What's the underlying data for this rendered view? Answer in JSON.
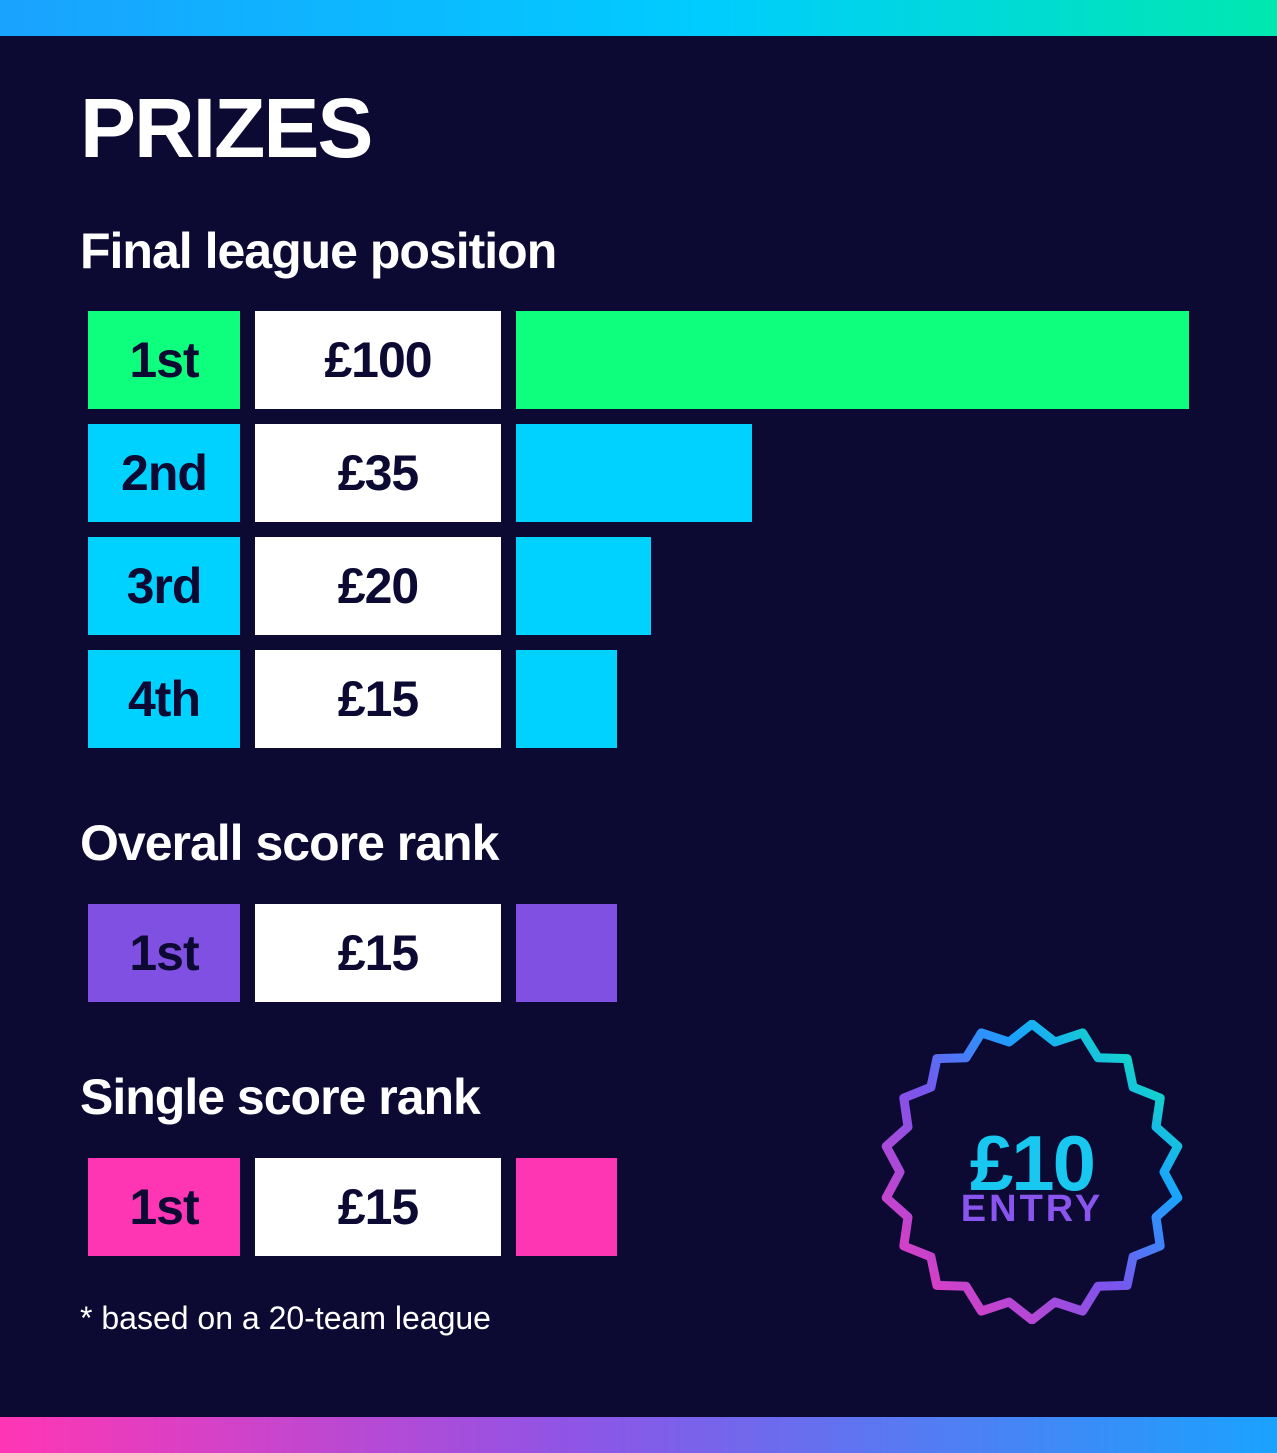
{
  "title": "PRIZES",
  "sections": {
    "final_league": {
      "heading": "Final league position",
      "rows": [
        {
          "position": "1st",
          "amount": "£100",
          "value": 100,
          "color": "#0eff7e"
        },
        {
          "position": "2nd",
          "amount": "£35",
          "value": 35,
          "color": "#00d2ff"
        },
        {
          "position": "3rd",
          "amount": "£20",
          "value": 20,
          "color": "#00d2ff"
        },
        {
          "position": "4th",
          "amount": "£15",
          "value": 15,
          "color": "#00d2ff"
        }
      ]
    },
    "overall_score": {
      "heading": "Overall score rank",
      "rows": [
        {
          "position": "1st",
          "amount": "£15",
          "value": 15,
          "color": "#8050e2"
        }
      ]
    },
    "single_score": {
      "heading": "Single score rank",
      "rows": [
        {
          "position": "1st",
          "amount": "£15",
          "value": 15,
          "color": "#ff36b4"
        }
      ]
    }
  },
  "footnote": "* based on a 20-team league",
  "badge": {
    "amount": "£10",
    "label": "ENTRY"
  },
  "colors": {
    "background": "#0c0a33",
    "dark_text": "#0c0a33",
    "cell_white": "#ffffff"
  }
}
